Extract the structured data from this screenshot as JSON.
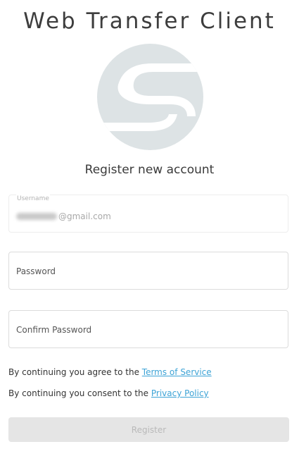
{
  "app": {
    "title": "Web Transfer Client",
    "logo_icon": "s-logo-icon",
    "logo_color": "#dde3e5"
  },
  "form": {
    "heading": "Register new account",
    "username": {
      "label": "Username",
      "value_visible_suffix": "@gmail.com",
      "value_prefix_redacted": true
    },
    "password": {
      "placeholder": "Password"
    },
    "confirm_password": {
      "placeholder": "Confirm Password"
    },
    "terms_line": {
      "prefix": "By continuing you agree to the",
      "link": "Terms of Service"
    },
    "privacy_line": {
      "prefix": "By continuing you consent to the",
      "link": "Privacy Policy"
    },
    "register_label": "Register",
    "register_enabled": false
  },
  "colors": {
    "link": "#3da3d6",
    "button_disabled_bg": "#e5e5e5",
    "button_disabled_text": "#b9b9b9"
  }
}
